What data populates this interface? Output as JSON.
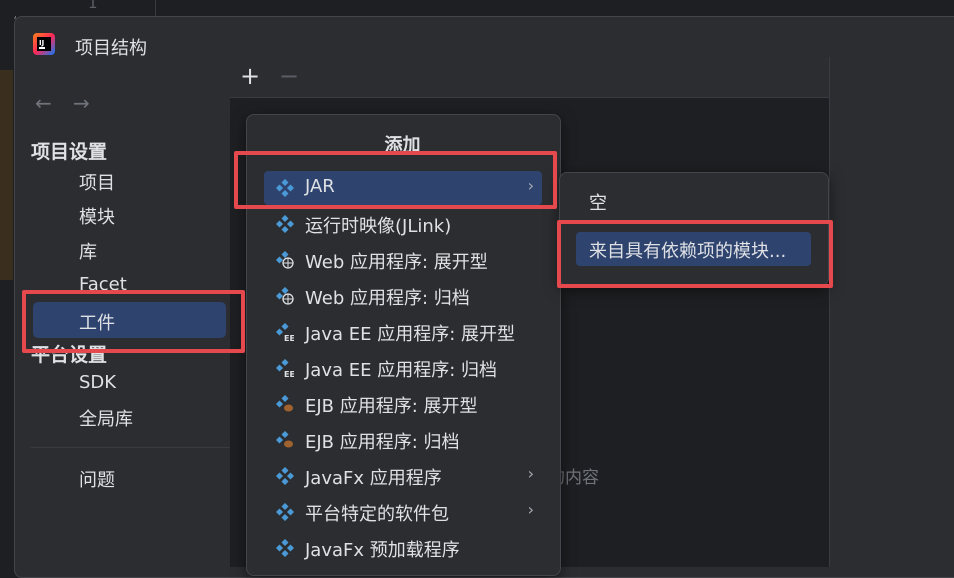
{
  "editor": {
    "line_number": "1"
  },
  "window": {
    "title": "项目结构"
  },
  "nav": {
    "back": "←",
    "forward": "→"
  },
  "sidebar": {
    "project_settings_header": "项目设置",
    "items": [
      "项目",
      "模块",
      "库",
      "Facet",
      "工件"
    ],
    "platform_settings_header": "平台设置",
    "platform_items": [
      "SDK",
      "全局库"
    ],
    "problems": "问题",
    "selected": "工件"
  },
  "toolbar": {
    "add": "+",
    "remove": "−"
  },
  "main": {
    "hint_fragment": "的内容"
  },
  "popup": {
    "title": "添加",
    "items": [
      {
        "label": "JAR",
        "icon": "jar-icon",
        "has_submenu": true,
        "selected": true
      },
      {
        "label": "运行时映像(JLink)",
        "icon": "artifact-icon"
      },
      {
        "label": "Web 应用程序: 展开型",
        "icon": "web-artifact-icon"
      },
      {
        "label": "Web 应用程序: 归档",
        "icon": "web-artifact-icon"
      },
      {
        "label": "Java EE 应用程序: 展开型",
        "icon": "javaee-artifact-icon"
      },
      {
        "label": "Java EE 应用程序: 归档",
        "icon": "javaee-artifact-icon"
      },
      {
        "label": "EJB 应用程序: 展开型",
        "icon": "ejb-artifact-icon"
      },
      {
        "label": "EJB 应用程序: 归档",
        "icon": "ejb-artifact-icon"
      },
      {
        "label": "JavaFx 应用程序",
        "icon": "artifact-icon",
        "has_submenu": true
      },
      {
        "label": "平台特定的软件包",
        "icon": "artifact-icon",
        "has_submenu": true
      },
      {
        "label": "JavaFx 预加载程序",
        "icon": "artifact-icon"
      }
    ]
  },
  "submenu": {
    "empty": "空",
    "from_modules": "来自具有依赖项的模块..."
  },
  "colors": {
    "selection": "#2e436e",
    "highlight": "#e5484d",
    "icon_blue": "#4a9ad8"
  }
}
